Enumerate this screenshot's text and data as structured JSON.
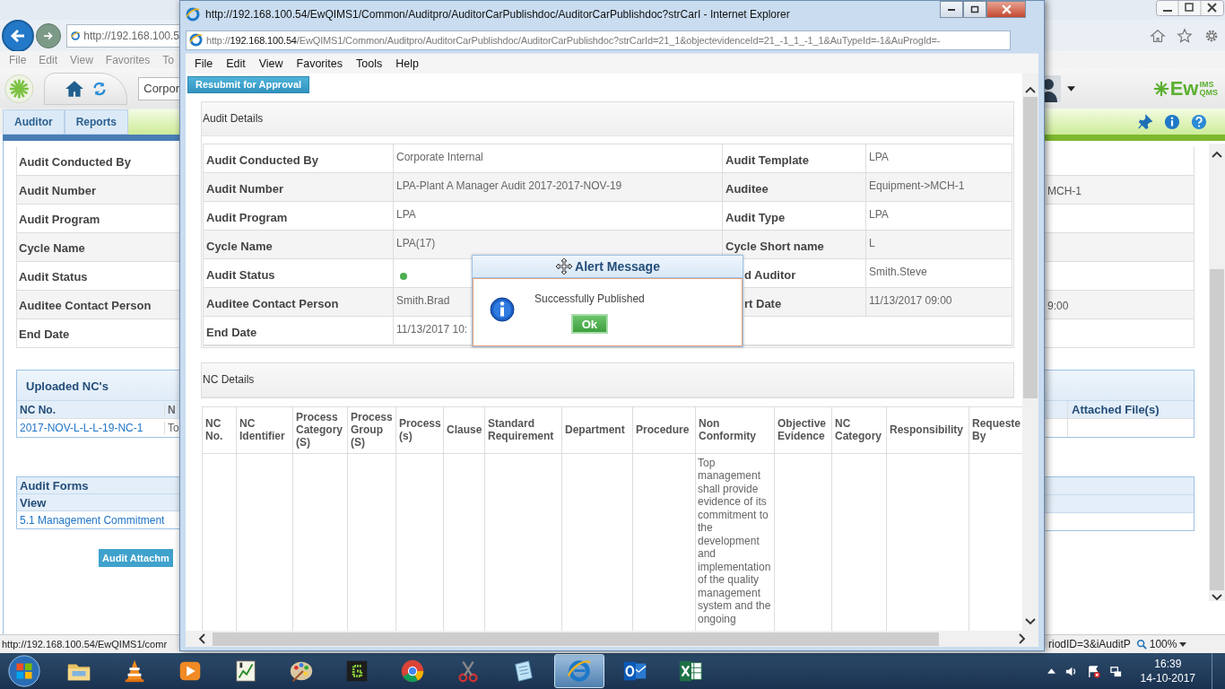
{
  "background_window": {
    "address": "http://192.168.100.5",
    "menu": [
      "File",
      "Edit",
      "View",
      "Favorites",
      "To"
    ],
    "search_value": "Corpor",
    "logo": {
      "main": "Ew",
      "top": "IMS",
      "bottom": "QMS"
    },
    "tabs": [
      "Auditor",
      "Reports"
    ],
    "detail_rows": [
      {
        "label": "Audit Conducted By"
      },
      {
        "label": "Audit Number",
        "right_value": "MCH-1"
      },
      {
        "label": "Audit Program"
      },
      {
        "label": "Cycle Name"
      },
      {
        "label": "Audit Status"
      },
      {
        "label": "Auditee Contact Person",
        "right_value": "9:00"
      },
      {
        "label": "End Date"
      }
    ],
    "uploaded_nc": {
      "title": "Uploaded NC's",
      "columns": [
        "NC No.",
        "N"
      ],
      "right_column": "Attached File(s)",
      "rows": [
        {
          "nc_no": "2017-NOV-L-L-L-19-NC-1",
          "column_2": "To"
        }
      ]
    },
    "audit_forms": {
      "title": "Audit Forms",
      "header": "View",
      "items": [
        "5.1 Management Commitment"
      ]
    },
    "attachment_button": "Audit Attachm",
    "status_left": "http://192.168.100.54/EwQIMS1/comr",
    "status_right": "riodID=3&iAuditP",
    "zoom": "100%"
  },
  "popup_window": {
    "title": "http://192.168.100.54/EwQIMS1/Common/Auditpro/AuditorCarPublishdoc/AuditorCarPublishdoc?strCarI - Internet Explorer",
    "address": {
      "scheme": "http://",
      "host": "192.168.100.54",
      "path": "/EwQIMS1/Common/Auditpro/AuditorCarPublishdoc/AuditorCarPublishdoc?strCarId=21_1&objectevidenceId=21_-1_1_-1_1&AuTypeId=-1&AuProgId=-"
    },
    "menu": [
      "File",
      "Edit",
      "View",
      "Favorites",
      "Tools",
      "Help"
    ],
    "resubmit_button": "Resubmit for Approval",
    "audit_details": {
      "title": "Audit Details",
      "rows": [
        {
          "label": "Audit Conducted By",
          "value": "Corporate Internal",
          "label_2": "Audit Template",
          "value_2": "LPA"
        },
        {
          "label": "Audit Number",
          "value": "LPA-Plant A Manager Audit 2017-2017-NOV-19",
          "label_2": "Auditee",
          "value_2": "Equipment->MCH-1"
        },
        {
          "label": "Audit Program",
          "value": "LPA",
          "label_2": "Audit Type",
          "value_2": "LPA"
        },
        {
          "label": "Cycle Name",
          "value": "LPA(17)",
          "label_2": "Cycle Short name",
          "value_2": "L"
        },
        {
          "label": "Audit Status",
          "color": "#4caf50",
          "label_2": "d Auditor",
          "value_2": "Smith.Steve"
        },
        {
          "label": "Auditee Contact Person",
          "value": "Smith.Brad",
          "label_2": "rt Date",
          "value_2": "11/13/2017 09:00"
        },
        {
          "label": "End Date",
          "value": "11/13/2017 10:"
        }
      ]
    },
    "nc_details": {
      "title": "NC Details",
      "columns": [
        {
          "label": "NC No."
        },
        {
          "label": "NC Identifier"
        },
        {
          "label": "Process Category (S)"
        },
        {
          "label": "Process Group (S)"
        },
        {
          "label": "Process (s)"
        },
        {
          "label": "Clause"
        },
        {
          "label": "Standard Requirement"
        },
        {
          "label": "Department"
        },
        {
          "label": "Procedure"
        },
        {
          "label": "Non Conformity",
          "kind": "non_conformity"
        },
        {
          "label": "Objective Evidence"
        },
        {
          "label": "NC Category"
        },
        {
          "label": "Responsibility"
        },
        {
          "label": "Requeste By"
        }
      ],
      "rows": [
        {
          "non_conformity": "Top management shall provide evidence of its commitment to the development and implementation of the quality management system and the ongoing"
        }
      ]
    }
  },
  "alert": {
    "title": "Alert Message",
    "message": "Successfully Published",
    "button": "Ok"
  },
  "taskbar": {
    "apps": [
      {
        "kind": "folder",
        "selected": false
      },
      {
        "kind": "cone",
        "selected": false
      },
      {
        "kind": "play",
        "selected": false
      },
      {
        "kind": "chart",
        "selected": false
      },
      {
        "kind": "palette",
        "selected": false
      },
      {
        "kind": "green",
        "selected": false
      },
      {
        "kind": "chrome",
        "selected": false
      },
      {
        "kind": "scissors",
        "selected": false
      },
      {
        "kind": "notepad",
        "selected": false
      },
      {
        "kind": "ie",
        "selected": true
      },
      {
        "kind": "mail",
        "selected": false
      },
      {
        "kind": "sheet",
        "selected": false
      }
    ],
    "time": "16:39",
    "date": "14-10-2017"
  }
}
